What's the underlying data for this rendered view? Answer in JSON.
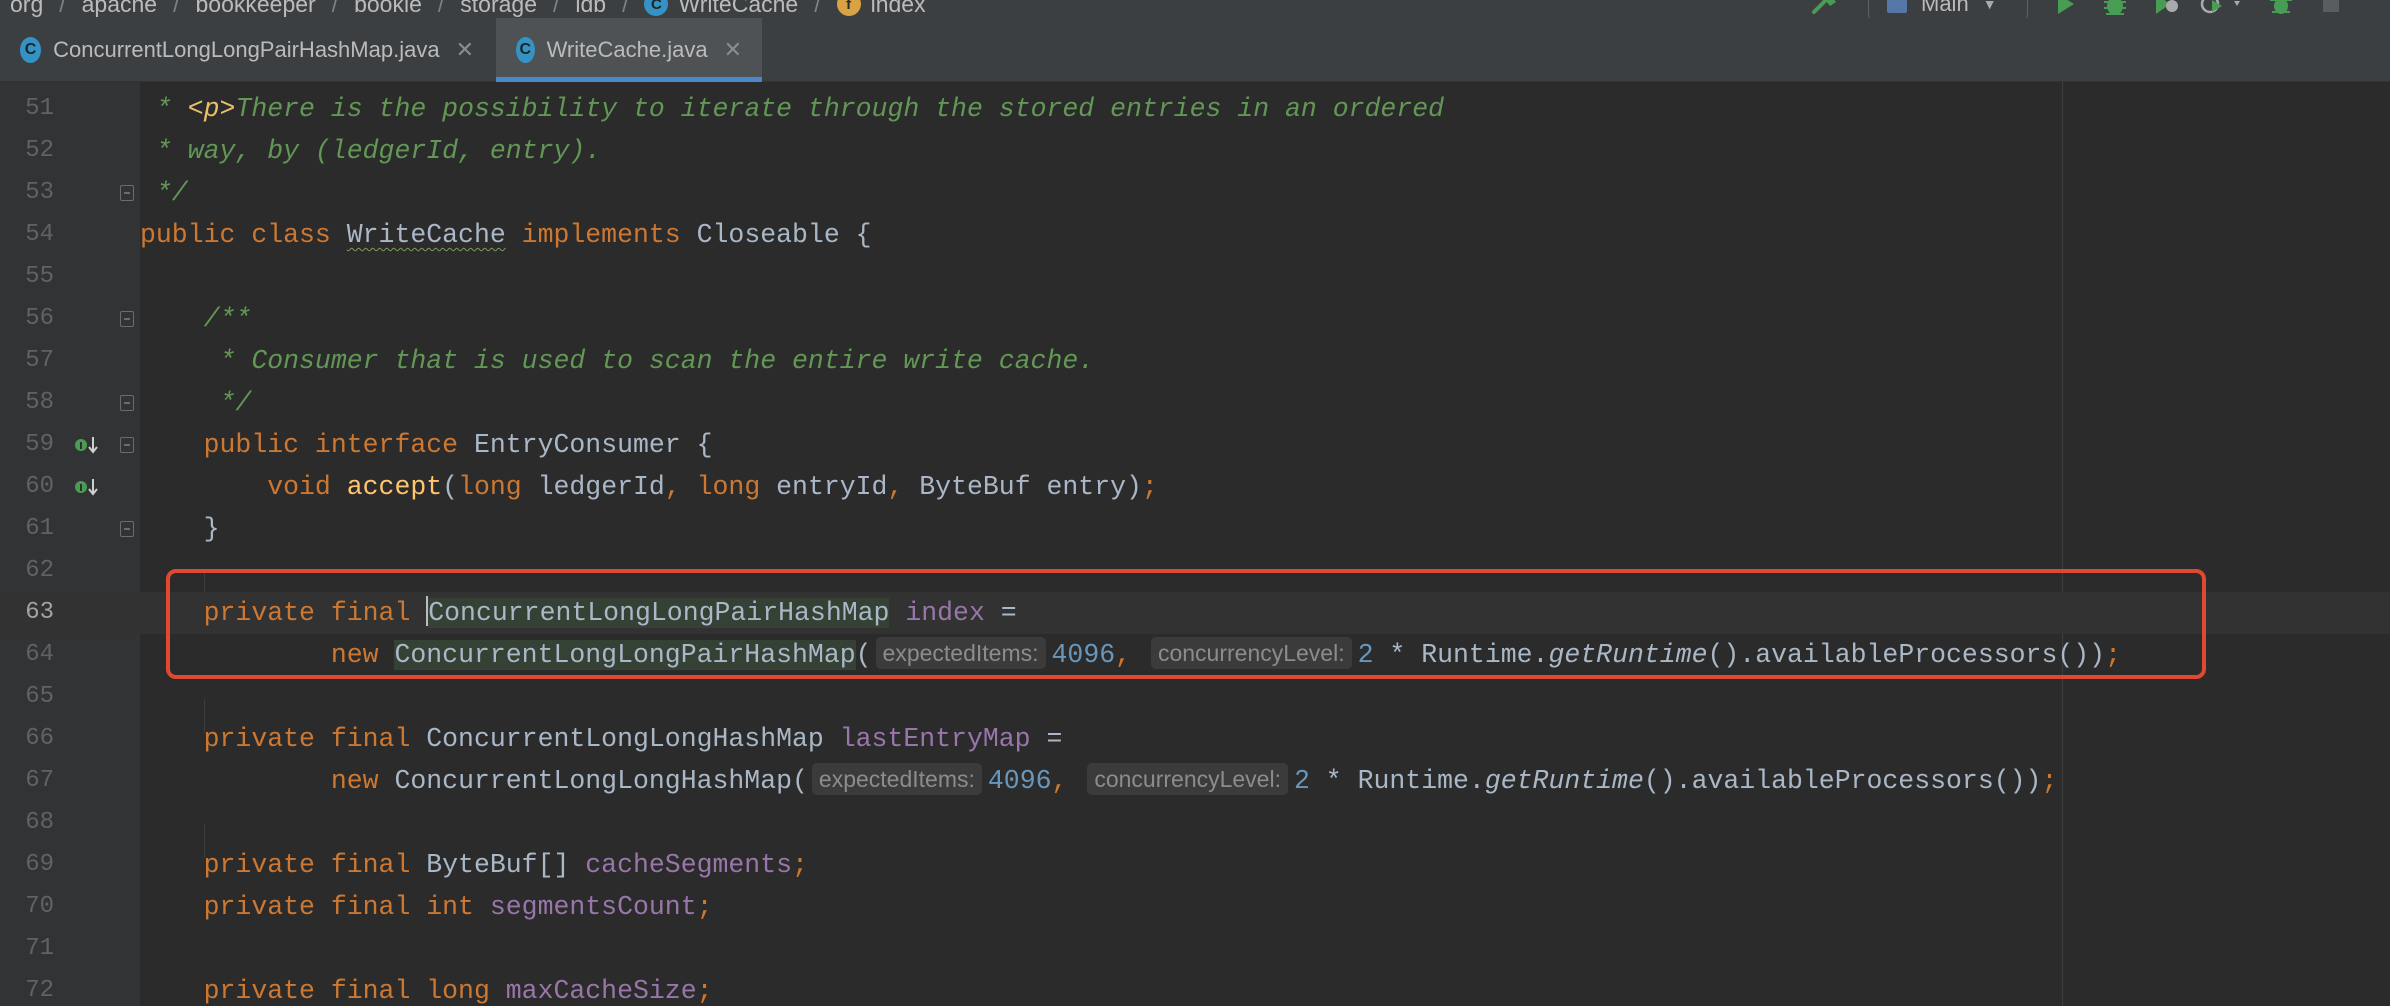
{
  "breadcrumbs": [
    "org",
    "apache",
    "bookkeeper",
    "bookie",
    "storage",
    "ldb",
    "WriteCache",
    "index"
  ],
  "toolbar": {
    "run_config": "Main"
  },
  "tabs": [
    {
      "label": "ConcurrentLongLongPairHashMap.java",
      "icon": "C",
      "active": false
    },
    {
      "label": "WriteCache.java",
      "icon": "C",
      "active": true
    }
  ],
  "editor": {
    "current_line": 63,
    "lines": [
      {
        "n": "51"
      },
      {
        "n": "52"
      },
      {
        "n": "53"
      },
      {
        "n": "54"
      },
      {
        "n": "55"
      },
      {
        "n": "56"
      },
      {
        "n": "57"
      },
      {
        "n": "58"
      },
      {
        "n": "59"
      },
      {
        "n": "60"
      },
      {
        "n": "61"
      },
      {
        "n": "62"
      },
      {
        "n": "63"
      },
      {
        "n": "64"
      },
      {
        "n": "65"
      },
      {
        "n": "66"
      },
      {
        "n": "67"
      },
      {
        "n": "68"
      },
      {
        "n": "69"
      },
      {
        "n": "70"
      },
      {
        "n": "71"
      },
      {
        "n": "72"
      }
    ],
    "code": {
      "l51_star": " * ",
      "l51_tag": "<p>",
      "l51_text": "There is the possibility to iterate through the stored entries in an ordered",
      "l52": " * way, by (ledgerId, entry).",
      "l53": " */",
      "l54_kw": "public class ",
      "l54_cls": "WriteCache",
      "l54_kw2": " implements ",
      "l54_rest": "Closeable {",
      "l56": "    /**",
      "l57": "     * Consumer that is used to scan the entire write cache.",
      "l58": "     */",
      "l59_kw": "    public interface ",
      "l59_rest": "EntryConsumer {",
      "l60_kw": "        void ",
      "l60_fn": "accept",
      "l60_p1": "(",
      "l60_kw2": "long ",
      "l60_p2": "ledgerId",
      "l60_c1": ", ",
      "l60_kw3": "long ",
      "l60_p3": "entryId",
      "l60_c2": ", ",
      "l60_p4": "ByteBuf entry)",
      "l60_end": ";",
      "l61": "    }",
      "l63_kw": "    private final ",
      "l63_type": "ConcurrentLongLongPairHashMap",
      "l63_fld": "index",
      "l63_eq": " =",
      "l64_kw": "            new ",
      "l64_type": "ConcurrentLongLongPairHashMap",
      "l64_paren": "(",
      "hint_expected": "expectedItems:",
      "l64_n1": "4096",
      "l64_comma": ",",
      "hint_concurrency": "concurrencyLevel:",
      "l64_n2": "2",
      "l64_star": " * Runtime.",
      "l64_get": "getRuntime",
      "l64_rest": "().availableProcessors())",
      "l64_end": ";",
      "l66_kw": "    private final ",
      "l66_type": "ConcurrentLongLongHashMap ",
      "l66_fld": "lastEntryMap",
      "l66_eq": " =",
      "l67_kw": "            new ",
      "l67_type": "ConcurrentLongLongHashMap(",
      "l67_n1": "4096",
      "l67_comma": ",",
      "l67_n2": "2",
      "l67_star": " * Runtime.",
      "l67_get": "getRuntime",
      "l67_rest": "().availableProcessors())",
      "l67_end": ";",
      "l69_kw": "    private final ",
      "l69_type": "ByteBuf[] ",
      "l69_fld": "cacheSegments",
      "l69_end": ";",
      "l70_kw": "    private final int ",
      "l70_fld": "segmentsCount",
      "l70_end": ";",
      "l72_kw": "    private final long ",
      "l72_fld": "maxCacheSize",
      "l72_end": ";"
    }
  },
  "colors": {
    "keyword": "#cc7832",
    "comment": "#629755",
    "field": "#9876aa",
    "number": "#6897bb",
    "method_decl": "#ffc66d",
    "highlight_box": "#e0482f",
    "active_tab_underline": "#4a88c7"
  },
  "icons": [
    "hammer-icon",
    "run-icon",
    "debug-icon",
    "coverage-icon",
    "profile-icon",
    "more-icon",
    "stop-icon",
    "class-icon",
    "field-icon",
    "override-icon",
    "fold-icon",
    "close-icon"
  ]
}
